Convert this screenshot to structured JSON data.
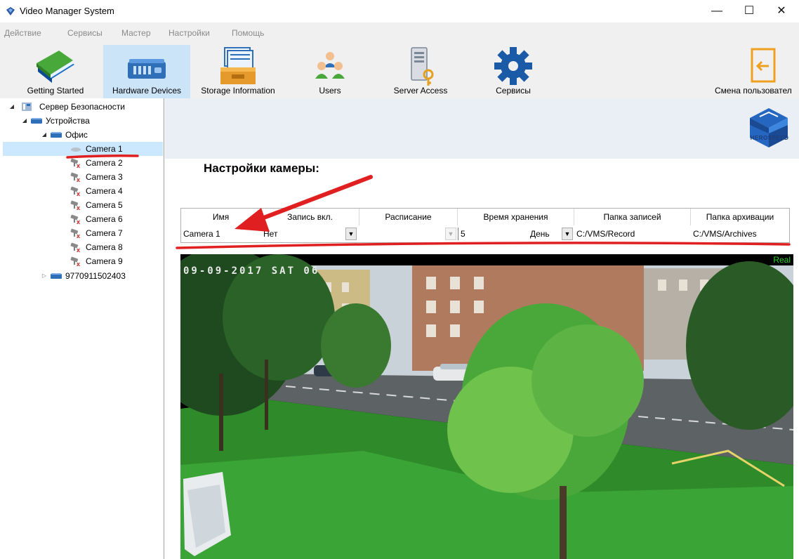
{
  "window": {
    "title": "Video Manager System",
    "controls": {
      "minimize": "—",
      "maximize": "☐",
      "close": "✕"
    }
  },
  "menu": [
    "Действие",
    "Сервисы",
    "Мастер",
    "Настройки",
    "Помощь"
  ],
  "toolbar": {
    "items": [
      {
        "label": "Getting Started",
        "icon": "book-icon"
      },
      {
        "label": "Hardware Devices",
        "icon": "server-rack-icon",
        "selected": true
      },
      {
        "label": "Storage Information",
        "icon": "storage-box-icon"
      },
      {
        "label": "Users",
        "icon": "users-icon"
      },
      {
        "label": "Server Access",
        "icon": "server-key-icon"
      },
      {
        "label": "Сервисы",
        "icon": "gear-icon"
      },
      {
        "label": "Смена пользовател",
        "icon": "exit-door-icon"
      }
    ]
  },
  "tree": {
    "root": "Сервер Безопасности",
    "devices": "Устройства",
    "group": "Офис",
    "cameras": [
      "Camera 1",
      "Camera 2",
      "Camera 3",
      "Camera 4",
      "Camera 5",
      "Camera 6",
      "Camera 7",
      "Camera 8",
      "Camera 9"
    ],
    "selected": "Camera 1",
    "other_device": "9770911502403"
  },
  "content": {
    "logo_text": "HEROSPEED",
    "section_title": "Настройки камеры:",
    "grid": {
      "headers": [
        "Имя",
        "Запись вкл.",
        "Расписание",
        "Время хранения",
        "Папка записей",
        "Папка архивации"
      ],
      "row": {
        "name": "Camera 1",
        "record": "Нет",
        "schedule": "",
        "retention_value": "5",
        "retention_unit": "День",
        "record_folder": "C:/VMS/Record",
        "archive_folder": "C:/VMS/Archives"
      }
    },
    "video": {
      "osd": "09-09-2017 SAT 06",
      "status": "Real"
    }
  },
  "colors": {
    "selection": "#cce4f7",
    "annotation": "#e02020",
    "osd_green": "#2bd12b"
  }
}
